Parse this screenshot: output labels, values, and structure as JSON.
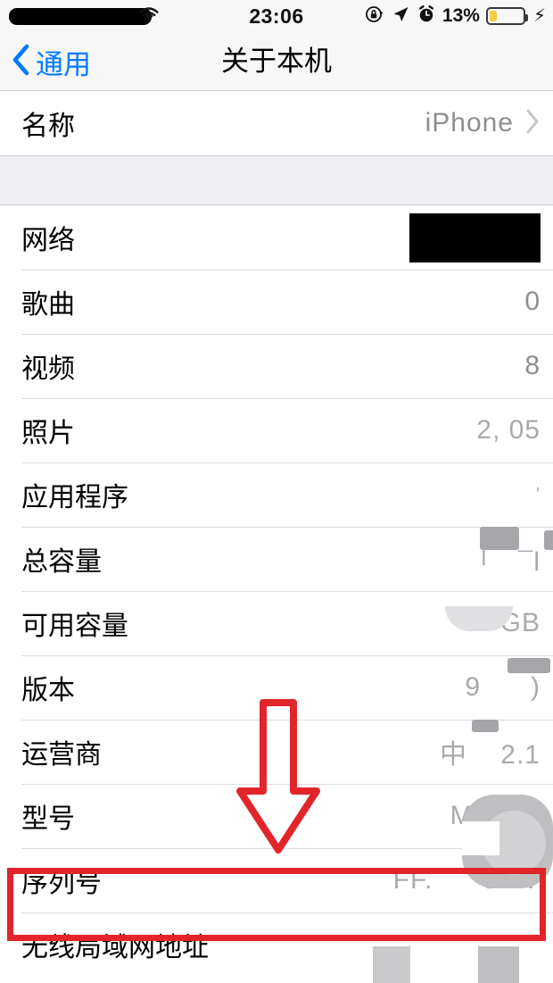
{
  "status_bar": {
    "carrier": "",
    "carrier_redacted": true,
    "wifi_icon": "wifi-icon",
    "time": "23:06",
    "rotation_lock_icon": "rotation-lock-icon",
    "location_icon": "location-arrow-icon",
    "alarm_icon": "alarm-clock-icon",
    "battery_percent": "13%",
    "battery_level": 13,
    "battery_color": "#F7CE46",
    "charging": true,
    "charging_icon": "lightning-bolt-icon"
  },
  "nav": {
    "back_label": "通用",
    "back_icon": "chevron-left-icon",
    "title": "关于本机",
    "tint_color": "#007AFF"
  },
  "sections": [
    {
      "rows": [
        {
          "label": "名称",
          "value": "iPhone",
          "chevron": true,
          "redacted": false
        }
      ]
    },
    {
      "rows": [
        {
          "label": "网络",
          "value": "",
          "chevron": false,
          "redacted": true
        },
        {
          "label": "歌曲",
          "value": "0",
          "chevron": false,
          "redacted": false
        },
        {
          "label": "视频",
          "value": "8",
          "chevron": false,
          "redacted": false
        },
        {
          "label": "照片",
          "value": "2, 05",
          "chevron": false,
          "redacted": false
        },
        {
          "label": "应用程序",
          "value": "'",
          "chevron": false,
          "redacted": false
        },
        {
          "label": "总容量",
          "value": "「   ¯l",
          "chevron": false,
          "redacted": false
        },
        {
          "label": "可用容量",
          "value": "GB",
          "chevron": false,
          "redacted": false
        },
        {
          "label": "版本",
          "value": "9      )",
          "chevron": false,
          "redacted": false
        },
        {
          "label": "运营商",
          "value": "中    2.1",
          "chevron": false,
          "redacted": false
        },
        {
          "label": "型号",
          "value": "M      A",
          "chevron": false,
          "redacted": false
        },
        {
          "label": "序列号",
          "value": "FF.      5MV",
          "chevron": false,
          "redacted": false
        },
        {
          "label": "无线局域网地址",
          "value": "",
          "chevron": false,
          "redacted": false
        }
      ]
    }
  ],
  "annotations": {
    "highlight_color": "#E1252B",
    "highlight_target": "序列号",
    "arrow_icon": "down-arrow-icon",
    "arrow_color": "#E1252B"
  }
}
